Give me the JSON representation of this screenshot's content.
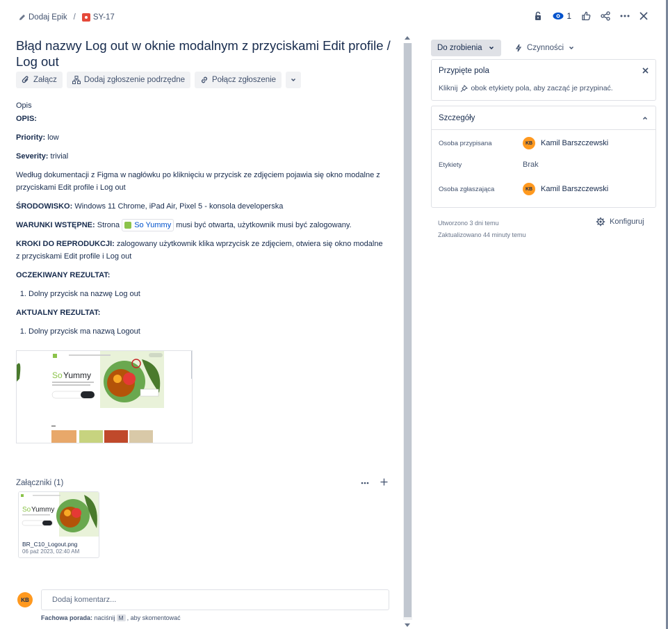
{
  "breadcrumb": {
    "epic": "Dodaj Epik",
    "separator": "/",
    "issue_key": "SY-17"
  },
  "top_actions": {
    "watchers": "1"
  },
  "issue": {
    "title": "Błąd nazwy Log out w oknie modalnym z przyciskami Edit profile / Log out",
    "buttons": {
      "attach": "Załącz",
      "child_issue": "Dodaj zgłoszenie podrzędne",
      "link_issue": "Połącz zgłoszenie"
    }
  },
  "description": {
    "section_label": "Opis",
    "opis_label": "OPIS:",
    "priority_label": "Priority:",
    "priority_value": "low",
    "severity_label": "Severity:",
    "severity_value": "trivial",
    "body": " Według dokumentacji z Figma w nagłówku po kliknięciu w przycisk ze zdjęciem pojawia się okno modalne z przyciskami Edit profile i Log out",
    "env_label": "ŚRODOWISKO:",
    "env_value": "Windows 11 Chrome,  iPad Air, Pixel 5 - konsola developerska",
    "pre_label": "WARUNKI WSTĘPNE:",
    "pre_before": "Strona",
    "pre_link": "So Yummy",
    "pre_after": "musi być otwarta, użytkownik musi być zalogowany.",
    "steps_label": "KROKI DO REPRODUKCJI:",
    "steps_value": "zalogowany użytkownik klika wprzycisk ze zdjęciem, otwiera się okno modalne z przyciskami Edit profile i Log out",
    "expected_label": "OCZEKIWANY REZULTAT:",
    "expected_items": [
      "Dolny przycisk na nazwę Log out"
    ],
    "actual_label": "AKTUALNY REZULTAT:",
    "actual_items": [
      "Dolny przycisk ma nazwą Logout"
    ]
  },
  "screenshot_preview": {
    "logo_text": "SoYummy"
  },
  "attachments": {
    "header": "Załączniki (1)",
    "items": [
      {
        "name": "BR_C10_Logout.png",
        "date": "06 paź 2023, 02:40 AM",
        "logo_text": "SoYummy"
      }
    ]
  },
  "comment": {
    "avatar": "KB",
    "placeholder": "Dodaj komentarz...",
    "tip_bold": "Fachowa porada:",
    "tip_before": "naciśnij",
    "tip_key": "M",
    "tip_after": ", aby skomentować"
  },
  "sidebar": {
    "status": "Do zrobienia",
    "actions": "Czynności",
    "pinned": {
      "title": "Przypięte pola",
      "hint_before": "Kliknij",
      "hint_after": "obok etykiety pola, aby zacząć je przypinać."
    },
    "details": {
      "title": "Szczegóły",
      "assignee_label": "Osoba przypisana",
      "assignee_avatar": "KB",
      "assignee": "Kamil Barszczewski",
      "labels_label": "Etykiety",
      "labels_value": "Brak",
      "reporter_label": "Osoba zgłaszająca",
      "reporter_avatar": "KB",
      "reporter": "Kamil Barszczewski"
    },
    "created": "Utworzono 3 dni temu",
    "updated": "Zaktualizowano 44 minuty temu",
    "configure": "Konfiguruj"
  },
  "colors": {
    "accent": "#0052cc",
    "avatar": "#ff991f",
    "bug": "#e5493a",
    "status_bg": "#dfe1e6"
  }
}
